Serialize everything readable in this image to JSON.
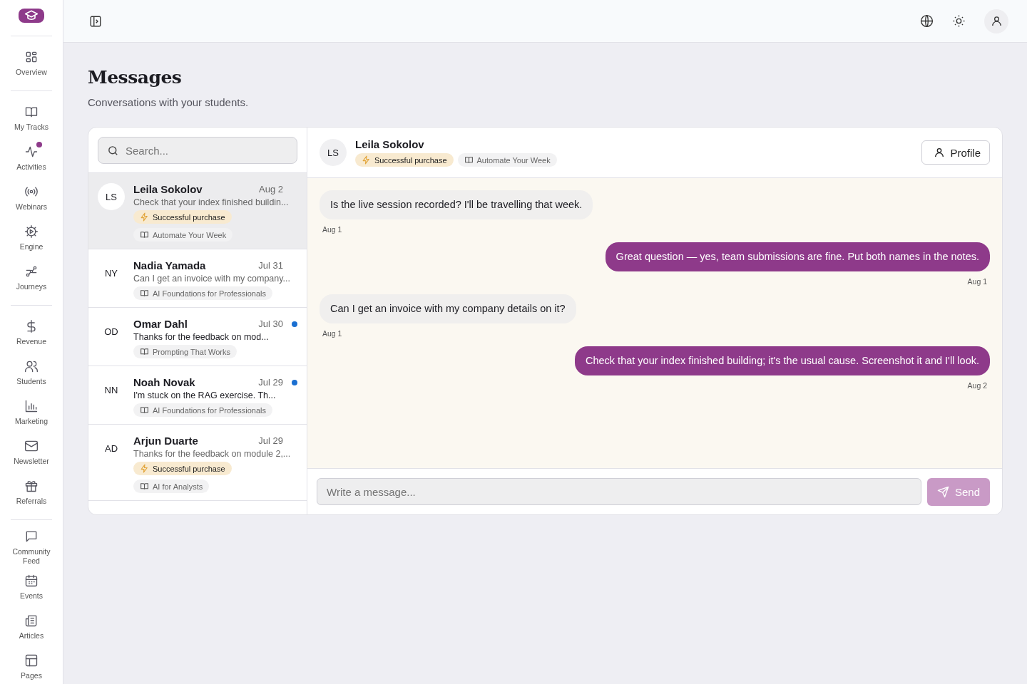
{
  "sidebar": {
    "groups": [
      [
        {
          "label": "Overview",
          "badge": false
        }
      ],
      [
        {
          "label": "My Tracks",
          "badge": false
        },
        {
          "label": "Activities",
          "badge": true
        },
        {
          "label": "Webinars",
          "badge": false
        },
        {
          "label": "Engine",
          "badge": false
        },
        {
          "label": "Journeys",
          "badge": false
        }
      ],
      [
        {
          "label": "Revenue",
          "badge": false
        },
        {
          "label": "Students",
          "badge": false
        },
        {
          "label": "Marketing",
          "badge": false
        },
        {
          "label": "Newsletter",
          "badge": false
        },
        {
          "label": "Referrals",
          "badge": false
        }
      ],
      [
        {
          "label": "Community Feed",
          "badge": false
        },
        {
          "label": "Events",
          "badge": false
        },
        {
          "label": "Articles",
          "badge": false
        },
        {
          "label": "Pages",
          "badge": false
        }
      ]
    ]
  },
  "page": {
    "title": "Messages",
    "subtitle": "Conversations with your students."
  },
  "search": {
    "placeholder": "Search..."
  },
  "conversations": [
    {
      "initials": "LS",
      "name": "Leila Sokolov",
      "date": "Aug 2",
      "preview": "Check that your index finished buildin...",
      "purchase": "Successful purchase",
      "course": "Automate Your Week",
      "selected": true,
      "unread": false
    },
    {
      "initials": "NY",
      "name": "Nadia Yamada",
      "date": "Jul 31",
      "preview": "Can I get an invoice with my company...",
      "course": "AI Foundations for Professionals",
      "selected": false,
      "unread": false
    },
    {
      "initials": "OD",
      "name": "Omar Dahl",
      "date": "Jul 30",
      "preview": "Thanks for the feedback on mod...",
      "course": "Prompting That Works",
      "selected": false,
      "unread": true
    },
    {
      "initials": "NN",
      "name": "Noah Novak",
      "date": "Jul 29",
      "preview": "I'm stuck on the RAG exercise. Th...",
      "course": "AI Foundations for Professionals",
      "selected": false,
      "unread": true
    },
    {
      "initials": "AD",
      "name": "Arjun Duarte",
      "date": "Jul 29",
      "preview": "Thanks for the feedback on module 2,...",
      "purchase": "Successful purchase",
      "course": "AI for Analysts",
      "selected": false,
      "unread": false
    }
  ],
  "chat": {
    "initials": "LS",
    "name": "Leila Sokolov",
    "purchase": "Successful purchase",
    "course": "Automate Your Week",
    "profile_button": "Profile",
    "messages": [
      {
        "kind": "incoming",
        "text": "Is the live session recorded? I'll be travelling that week.",
        "time": "Aug 1"
      },
      {
        "kind": "outgoing",
        "text": "Great question — yes, team submissions are fine. Put both names in the notes.",
        "time": "Aug 1"
      },
      {
        "kind": "incoming",
        "text": "Can I get an invoice with my company details on it?",
        "time": "Aug 1"
      },
      {
        "kind": "outgoing",
        "text": "Check that your index finished building; it's the usual cause. Screenshot it and I'll look.",
        "time": "Aug 2"
      }
    ],
    "composer": {
      "placeholder": "Write a message...",
      "send": {
        "label": "Send",
        "disabled": true
      }
    }
  }
}
